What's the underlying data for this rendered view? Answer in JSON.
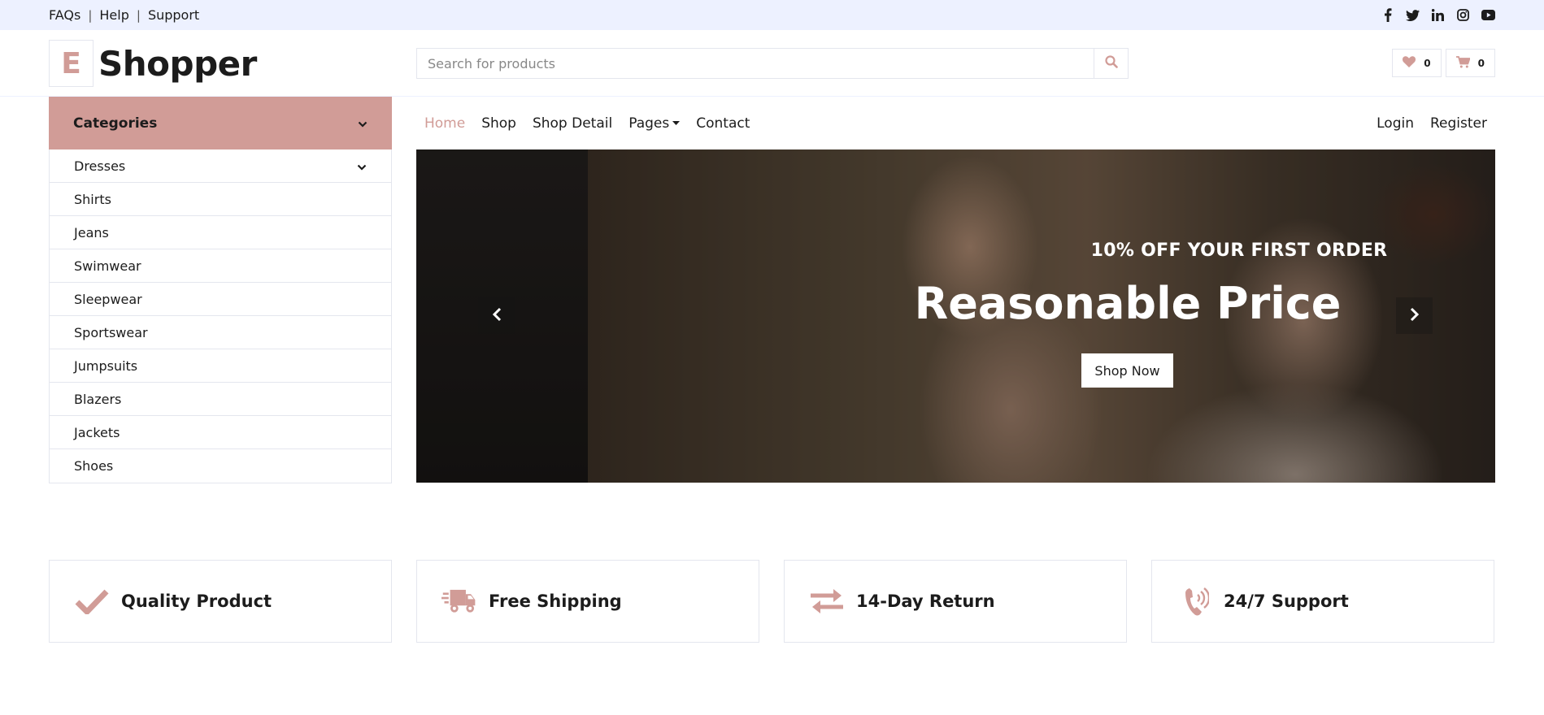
{
  "topbar": {
    "links": [
      "FAQs",
      "Help",
      "Support"
    ],
    "social_icons": [
      "facebook-icon",
      "twitter-icon",
      "linkedin-icon",
      "instagram-icon",
      "youtube-icon"
    ]
  },
  "header": {
    "logo_letter": "E",
    "logo_text": "Shopper",
    "search_placeholder": "Search for products",
    "wishlist_count": "0",
    "cart_count": "0"
  },
  "categories": {
    "title": "Categories",
    "items": [
      "Dresses",
      "Shirts",
      "Jeans",
      "Swimwear",
      "Sleepwear",
      "Sportswear",
      "Jumpsuits",
      "Blazers",
      "Jackets",
      "Shoes"
    ]
  },
  "nav": {
    "items": [
      "Home",
      "Shop",
      "Shop Detail",
      "Pages",
      "Contact"
    ],
    "active": "Home",
    "right": [
      "Login",
      "Register"
    ]
  },
  "hero": {
    "subtitle": "10% OFF YOUR FIRST ORDER",
    "title": "Reasonable Price",
    "button": "Shop Now"
  },
  "features": [
    {
      "label": "Quality Product",
      "icon": "check-icon"
    },
    {
      "label": "Free Shipping",
      "icon": "shipping-fast-icon"
    },
    {
      "label": "14-Day Return",
      "icon": "exchange-icon"
    },
    {
      "label": "24/7 Support",
      "icon": "phone-volume-icon"
    }
  ],
  "colors": {
    "accent": "#d19c97",
    "topbar_bg": "#edf1ff",
    "border": "#e4e6ee",
    "text": "#1c1c1c"
  }
}
